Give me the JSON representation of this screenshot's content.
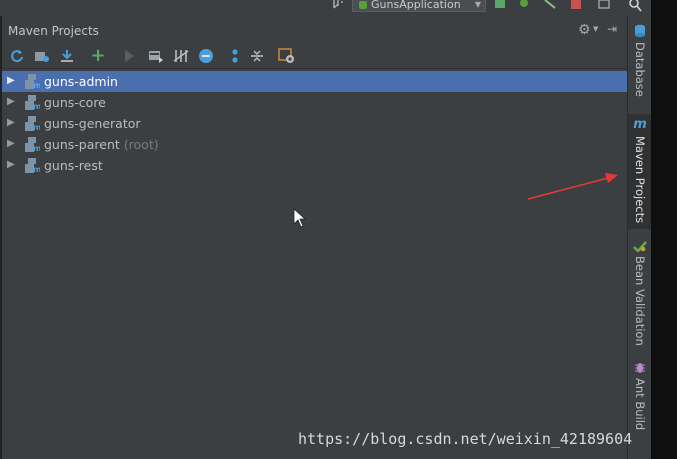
{
  "top_toolbar": {
    "run_config": "GunsApplication",
    "colors": {
      "run": "#59a869",
      "debug": "#5a9d3f",
      "stop": "#c75450"
    }
  },
  "panel": {
    "title": "Maven Projects",
    "toolbar_icons": [
      "refresh-icon",
      "generate-sources-icon",
      "download-icon",
      "add-icon",
      "run-icon",
      "execute-goal-icon",
      "toggle-offline-icon",
      "skip-tests-icon",
      "show-dependencies-icon",
      "collapse-all-icon",
      "settings-icon"
    ]
  },
  "tree": {
    "items": [
      {
        "label": "guns-admin",
        "suffix": "",
        "selected": true
      },
      {
        "label": "guns-core",
        "suffix": "",
        "selected": false
      },
      {
        "label": "guns-generator",
        "suffix": "",
        "selected": false
      },
      {
        "label": "guns-parent",
        "suffix": "(root)",
        "selected": false
      },
      {
        "label": "guns-rest",
        "suffix": "",
        "selected": false
      }
    ]
  },
  "side_tabs": {
    "database": "Database",
    "maven": "Maven Projects",
    "bean": "Bean Validation",
    "ant": "Ant Build"
  },
  "watermark": "https://blog.csdn.net/weixin_42189604",
  "colors": {
    "selection": "#4b6eaf",
    "panel_bg": "#3c3f41",
    "annotation_arrow": "#e53935"
  }
}
